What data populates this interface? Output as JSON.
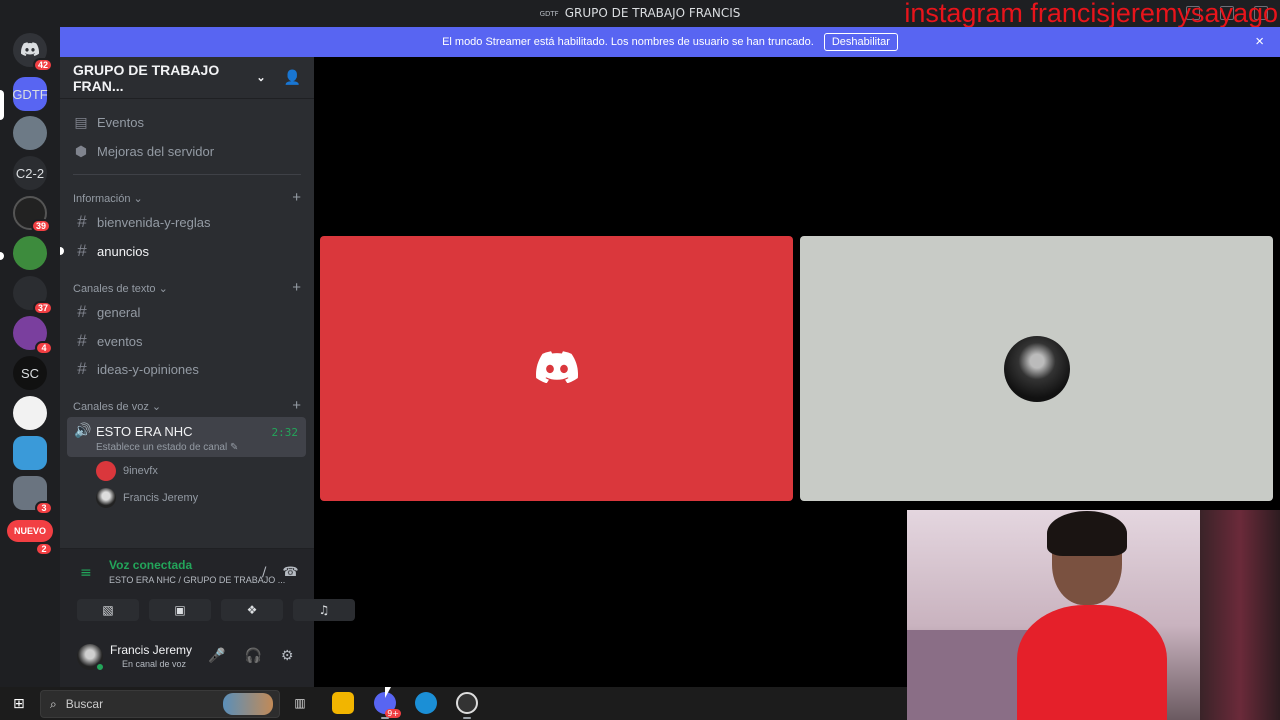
{
  "window": {
    "title": "GRUPO DE TRABAJO FRANCIS",
    "title_prefix": "GDTF",
    "overlay_text": "instagram francisjeremysayago"
  },
  "banner": {
    "message": "El modo Streamer está habilitado. Los nombres de usuario se han truncado.",
    "button_label": "Deshabilitar",
    "close_icon": "×"
  },
  "server_rail": {
    "items": [
      {
        "label": "",
        "icon": "discord-icon",
        "badge": "42"
      },
      {
        "label": "GDTF",
        "badge": ""
      },
      {
        "label": "",
        "badge": ""
      },
      {
        "label": "C2-2",
        "badge": ""
      },
      {
        "label": "",
        "badge": "39"
      },
      {
        "label": "",
        "badge": ""
      },
      {
        "label": "",
        "badge": "37"
      },
      {
        "label": "",
        "badge": "4"
      },
      {
        "label": "SC",
        "badge": ""
      },
      {
        "label": "",
        "badge": ""
      },
      {
        "label": "",
        "badge": ""
      },
      {
        "label": "",
        "badge": "3"
      },
      {
        "label": "NUEVO",
        "badge": "2"
      }
    ]
  },
  "sidebar": {
    "server_name": "GRUPO DE TRABAJO FRAN...",
    "nav": [
      {
        "label": "Eventos",
        "icon": "calendar-icon"
      },
      {
        "label": "Mejoras del servidor",
        "icon": "boost-icon"
      }
    ],
    "categories": [
      {
        "label": "Información",
        "channels": [
          "bienvenida-y-reglas",
          "anuncios"
        ]
      },
      {
        "label": "Canales de texto",
        "channels": [
          "general",
          "eventos",
          "ideas-y-opiniones"
        ]
      },
      {
        "label": "Canales de voz",
        "channels": []
      }
    ],
    "voice_channel": {
      "name": "ESTO ERA NHC",
      "status": "Establece un estado de canal",
      "time": "2:32",
      "members": [
        "9inevfx",
        "Francis Jeremy"
      ]
    }
  },
  "rtc": {
    "status": "Voz conectada",
    "location": "ESTO ERA NHC / GRUPO DE TRABAJO ..."
  },
  "user": {
    "name": "Francis Jeremy",
    "status": "En canal de voz"
  },
  "taskbar": {
    "search_placeholder": "Buscar",
    "discord_badge": "9+"
  },
  "colors": {
    "blurple": "#5865f2",
    "red_tile": "#da373c",
    "green": "#23a55a"
  }
}
